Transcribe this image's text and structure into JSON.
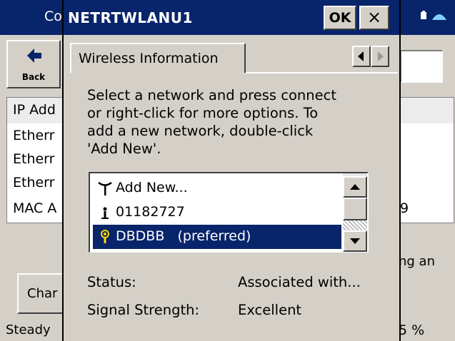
{
  "background_window": {
    "title_partial": "Co",
    "back_label": "Back",
    "list_rows": [
      "IP Add",
      "Etherr",
      "Etherr",
      "Etherr",
      "MAC A"
    ],
    "right_row_value": "9",
    "note_partial": "ng an",
    "change_button_partial": "Char",
    "bottom_left_partial": "Steady",
    "bottom_right_partial": "5 %"
  },
  "dialog": {
    "title": "NETRTWLANU1",
    "ok_label": "OK",
    "close_label": "×",
    "tab_label": "Wireless Information",
    "instructions": "Select a network and press connect\nor right-click for more options.  To\nadd a new network, double-click\n'Add New'.",
    "networks": [
      {
        "label": "Add New...",
        "icon": "antenna-icon",
        "selected": false
      },
      {
        "label": "01182727",
        "icon": "adhoc-station-icon",
        "selected": false
      },
      {
        "label": "DBDBB   (preferred)",
        "icon": "access-point-icon",
        "selected": true
      }
    ],
    "status_label": "Status:",
    "status_value": "Associated with...",
    "signal_label": "Signal Strength:",
    "signal_value": "Excellent"
  },
  "colors": {
    "titlebar": "#08246b",
    "face": "#d4d0c8",
    "selection": "#08246b"
  }
}
